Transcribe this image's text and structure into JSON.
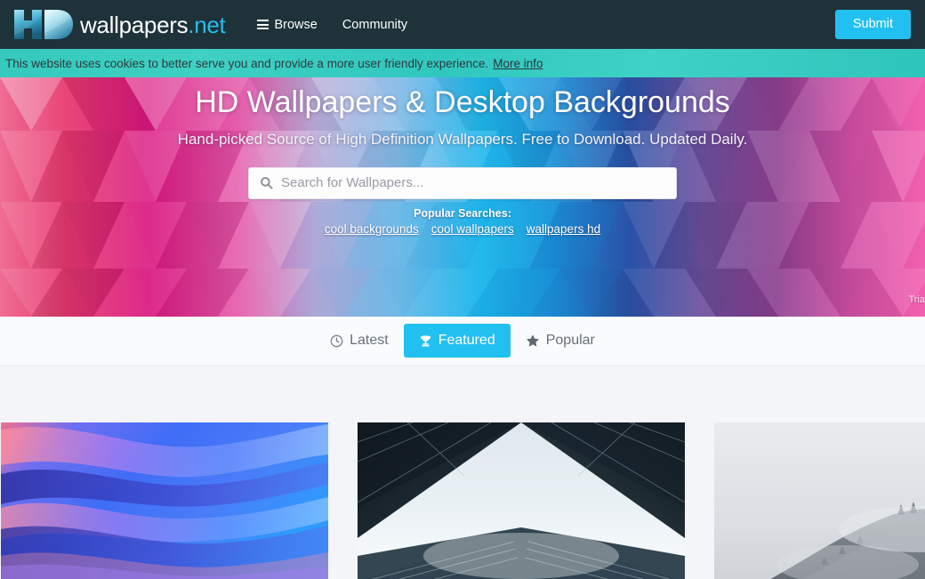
{
  "header": {
    "logo": {
      "mark": "hd-monogram",
      "name": "wallpapers",
      "tld": ".net"
    },
    "nav": [
      {
        "label": "Browse",
        "icon": "hamburger-icon"
      },
      {
        "label": "Community",
        "icon": null
      }
    ],
    "submit_label": "Submit",
    "bg_color": "#1d3239",
    "accent_color": "#22c0f0"
  },
  "cookie_bar": {
    "message": "This website uses cookies to better serve you and provide a more user friendly experience.",
    "more_label": "More info",
    "bg_color": "#35c9bd"
  },
  "hero": {
    "title": "HD Wallpapers & Desktop Backgrounds",
    "subtitle": "Hand-picked Source of High Definition Wallpapers. Free to Download. Updated Daily.",
    "search": {
      "placeholder": "Search for Wallpapers...",
      "value": "",
      "icon": "search-icon"
    },
    "popular_label": "Popular Searches:",
    "popular_links": [
      "cool backgrounds",
      "cool wallpapers",
      "wallpapers hd"
    ],
    "credit": "Tria"
  },
  "tabs": [
    {
      "label": "Latest",
      "icon": "clock-icon",
      "active": false
    },
    {
      "label": "Featured",
      "icon": "trophy-icon",
      "active": true
    },
    {
      "label": "Popular",
      "icon": "star-icon",
      "active": false
    }
  ],
  "gallery": {
    "items": [
      {
        "name": "abstract-waves-thumbnail",
        "description": "Blue purple and pink abstract gradient waves"
      },
      {
        "name": "architecture-symmetry-thumbnail",
        "description": "Symmetrical modern building looking up at bright sky"
      },
      {
        "name": "misty-mountain-thumbnail",
        "description": "Snow covered mountain ridge in heavy fog"
      }
    ]
  }
}
